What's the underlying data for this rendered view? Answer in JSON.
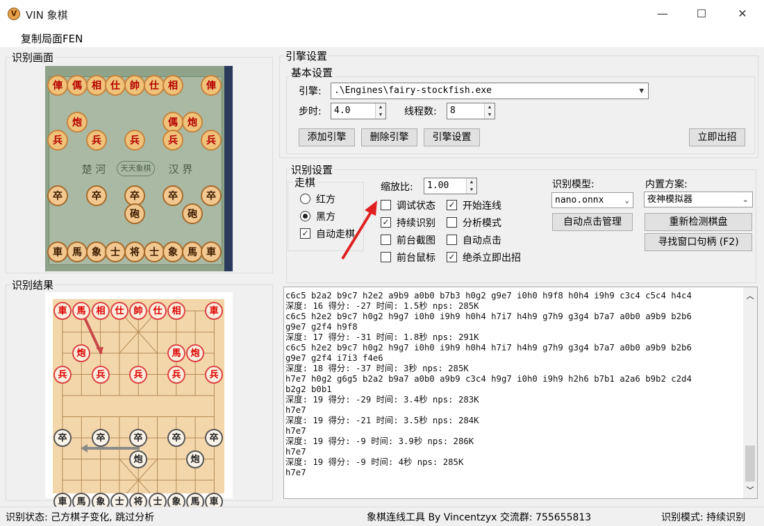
{
  "window": {
    "title": "VIN 象棋",
    "minimize": "—",
    "maximize": "☐",
    "close": "✕"
  },
  "menu": {
    "copy_fen": "复制局面FEN"
  },
  "recognition_view": {
    "label": "识别画面",
    "top_row": [
      "俥",
      "傌",
      "相",
      "仕",
      "帥",
      "仕",
      "相",
      "俥"
    ],
    "cannons": [
      "炮",
      "傌",
      "炮"
    ],
    "pawns": [
      "兵",
      "兵",
      "兵",
      "兵",
      "兵"
    ],
    "river_left": "楚 河",
    "river_mid": "天天象棋",
    "river_right": "汉 界",
    "soldiers": [
      "卒",
      "卒",
      "卒",
      "卒",
      "卒"
    ],
    "black_cannons": [
      "砲",
      "砲"
    ],
    "bottom_row": [
      "車",
      "馬",
      "象",
      "士",
      "将",
      "士",
      "象",
      "馬",
      "車"
    ]
  },
  "recognition_result": {
    "label": "识别结果",
    "top_row": [
      "車",
      "馬",
      "相",
      "仕",
      "帥",
      "仕",
      "相",
      "車"
    ],
    "row3": [
      "炮",
      "馬",
      "炮"
    ],
    "pawns": [
      "兵",
      "兵",
      "兵",
      "兵",
      "兵"
    ],
    "soldiers": [
      "卒",
      "卒",
      "卒",
      "卒",
      "卒"
    ],
    "cannons": [
      "炮",
      "炮"
    ],
    "bottom_row": [
      "車",
      "馬",
      "象",
      "士",
      "将",
      "士",
      "象",
      "馬",
      "車"
    ]
  },
  "engine": {
    "group_label": "引擎设置",
    "basic_label": "基本设置",
    "engine_label": "引擎:",
    "engine_value": ".\\Engines\\fairy-stockfish.exe",
    "step_label": "步时:",
    "step_value": "4.0",
    "threads_label": "线程数:",
    "threads_value": "8",
    "add_btn": "添加引擎",
    "del_btn": "删除引擎",
    "settings_btn": "引擎设置",
    "move_now_btn": "立即出招"
  },
  "recog": {
    "group_label": "识别设置",
    "move_group": "走棋",
    "red": "红方",
    "black": "黑方",
    "auto_move": "自动走棋",
    "scale_label": "缩放比:",
    "scale_value": "1.00",
    "debug": "调试状态",
    "start_link": "开始连线",
    "continuous": "持续识别",
    "analysis": "分析模式",
    "front_capture": "前台截图",
    "auto_click": "自动点击",
    "front_mouse": "前台鼠标",
    "kill_move": "绝杀立即出招",
    "model_label": "识别模型:",
    "model_value": "nano.onnx",
    "auto_click_mgr": "自动点击管理",
    "preset_label": "内置方案:",
    "preset_value": "夜神模拟器",
    "redetect_btn": "重新检测棋盘",
    "find_handle_btn": "寻找窗口句柄 (F2)"
  },
  "log": [
    "c6c5 b2a2 b9c7 h2e2 a9b9 a0b0 b7b3 h0g2 g9e7 i0h0 h9f8 h0h4 i9h9 c3c4 c5c4 h4c4",
    "深度: 16 得分: -27 时间: 1.5秒 nps: 285K",
    "c6c5 h2e2 b9c7 h0g2 h9g7 i0h0 i9h9 h0h4 h7i7 h4h9 g7h9 g3g4 b7a7 a0b0 a9b9 b2b6",
    "g9e7 g2f4 h9f8",
    "深度: 17 得分: -31 时间: 1.8秒 nps: 291K",
    "c6c5 h2e2 b9c7 h0g2 h9g7 i0h0 i9h9 h0h4 h7i7 h4h9 g7h9 g3g4 b7a7 a0b0 a9b9 b2b6",
    "g9e7 g2f4 i7i3 f4e6",
    "深度: 18 得分: -37 时间: 3秒 nps: 285K",
    "h7e7 h0g2 g6g5 b2a2 b9a7 a0b0 a9b9 c3c4 h9g7 i0h0 i9h9 h2h6 b7b1 a2a6 b9b2 c2d4",
    "b2g2 b0b1",
    "深度: 19 得分: -29 时间: 3.4秒 nps: 283K",
    "h7e7",
    "深度: 19 得分: -21 时间: 3.5秒 nps: 284K",
    "h7e7",
    "深度: 19 得分: -9 时间: 3.9秒 nps: 286K",
    "h7e7",
    "深度: 19 得分: -9 时间: 4秒 nps: 285K",
    "h7e7"
  ],
  "status": {
    "left": "识别状态: 己方棋子变化, 跳过分析",
    "center": "象棋连线工具 By Vincentzyx 交流群: 755655813",
    "right": "识别模式: 持续识别"
  },
  "colors": {
    "accent_arrow": "#e02020",
    "board_bg": "#f3d7ab"
  }
}
